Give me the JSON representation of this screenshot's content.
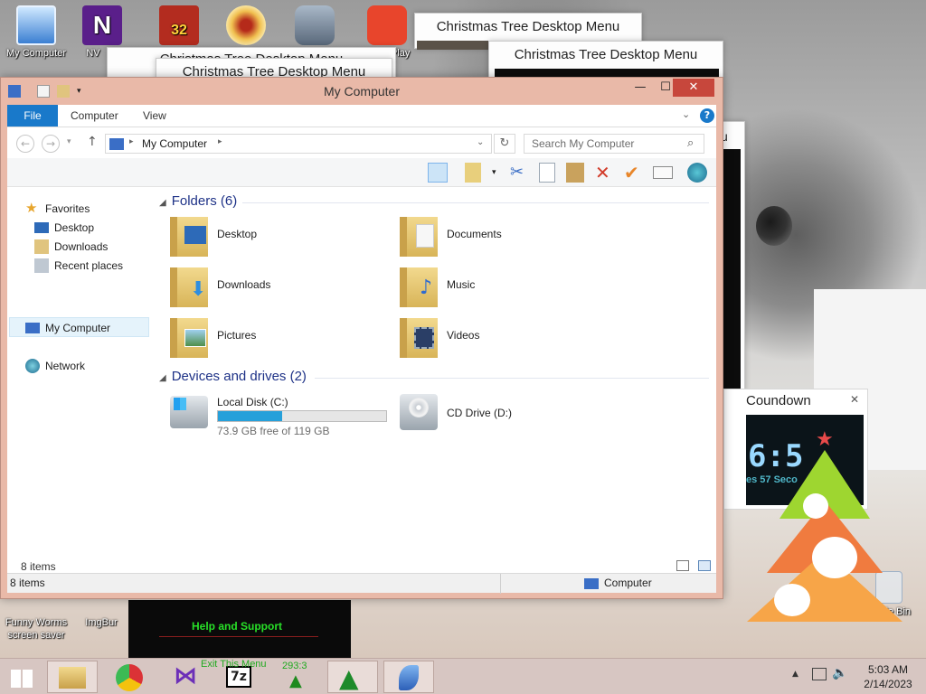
{
  "desktop": {
    "icons_top": [
      {
        "label": "My Computer"
      },
      {
        "label": "NV"
      },
      {
        "label": ""
      },
      {
        "label": ""
      },
      {
        "label": ""
      },
      {
        "label": "GOM Play"
      }
    ],
    "icons_bottom": [
      {
        "label": "Funny Worms screen saver"
      },
      {
        "label": "ImgBur"
      },
      {
        "label": "Recycle Bin"
      }
    ],
    "badge_32": "32"
  },
  "bg_windows": {
    "menu_title_1": "Christmas Tree Desktop Menu",
    "menu_title_2": "Christmas Tree Desktop Menu",
    "menu_title_3": "Christmas Tree Desktop Menu",
    "menu_title_4": "Christmas Tree Desktop Menu",
    "partial_u": "u",
    "help_support": "Help and Support",
    "exit_menu": "Exit This Menu",
    "counter": "293:3"
  },
  "countdown": {
    "title": "Coundown",
    "close": "✕",
    "digits": "6:5",
    "seconds_text": "es 57 Seco"
  },
  "window": {
    "title": "My Computer",
    "controls": {
      "minimize": "—",
      "maximize": "☐",
      "close": "✕"
    },
    "ribbon_tabs": [
      "File",
      "Computer",
      "View"
    ],
    "address": "My Computer",
    "search_placeholder": "Search My Computer",
    "nav": {
      "favorites": "Favorites",
      "desktop": "Desktop",
      "downloads": "Downloads",
      "recent": "Recent places",
      "mycomputer": "My Computer",
      "network": "Network"
    },
    "folders_header": "Folders (6)",
    "folders": [
      "Desktop",
      "Documents",
      "Downloads",
      "Music",
      "Pictures",
      "Videos"
    ],
    "devices_header": "Devices and drives (2)",
    "drives": [
      {
        "name": "Local Disk (C:)",
        "free": "73.9 GB free of 119 GB",
        "used_fraction": 0.38
      },
      {
        "name": "CD Drive (D:)"
      }
    ],
    "item_count": "8 items",
    "status_left": "8 items",
    "status_right": "Computer"
  },
  "taskbar": {
    "time": "5:03 AM",
    "date": "2/14/2023",
    "seven_zip": "7z"
  },
  "colors": {
    "accent": "#1979ca",
    "window_frame": "#e9b9a8",
    "close_red": "#c7473c",
    "progress": "#26a0da",
    "group_header": "#1e3287"
  }
}
